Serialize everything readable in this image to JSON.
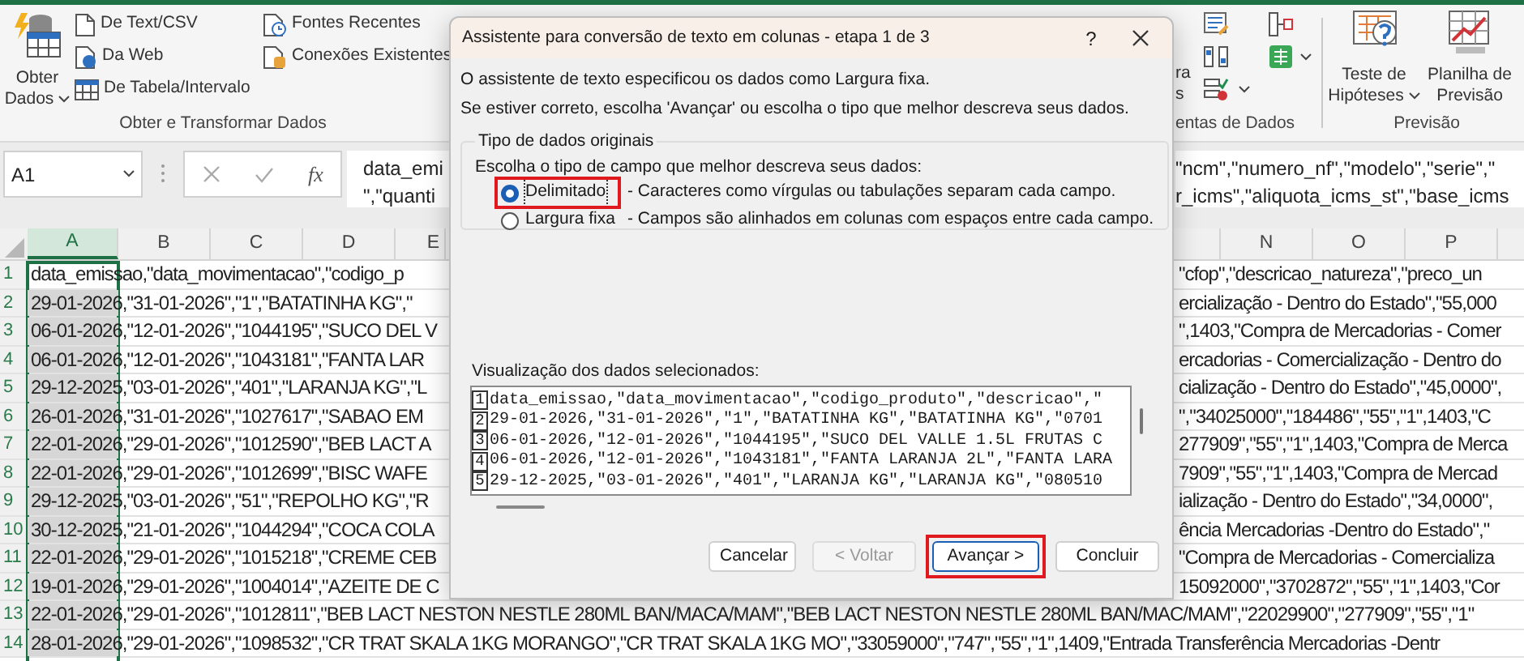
{
  "ribbon": {
    "groups": [
      {
        "label": "Obter e Transformar Dados",
        "items": [
          {
            "kind": "large",
            "lines": [
              "Obter",
              "Dados"
            ],
            "dropdown": true
          },
          {
            "kind": "small",
            "label": "De Text/CSV"
          },
          {
            "kind": "small",
            "label": "Da Web"
          },
          {
            "kind": "small",
            "label": "De Tabela/Intervalo"
          },
          {
            "kind": "small",
            "label": "Fontes Recentes"
          },
          {
            "kind": "small",
            "label": "Conexões Existentes"
          }
        ]
      },
      {
        "label": "entas de Dados",
        "items": [
          {
            "kind": "fragment",
            "lines": [
              "ra",
              "s"
            ]
          }
        ]
      },
      {
        "label": "Previsão",
        "items": [
          {
            "kind": "large",
            "lines": [
              "Teste de",
              "Hipóteses"
            ],
            "dropdown": true
          },
          {
            "kind": "large",
            "lines": [
              "Planilha de",
              "Previsão"
            ],
            "dropdown": false
          }
        ]
      }
    ]
  },
  "formula_bar": {
    "name_box": "A1",
    "function_label": "fx",
    "lines_left": [
      "data_emi",
      "\",\"quanti"
    ],
    "lines_right": [
      "\"ncm\",\"numero_nf\",\"modelo\",\"serie\",\"",
      "r_icms\",\"aliquota_icms_st\",\"base_icms"
    ]
  },
  "sheet": {
    "columns_left": [
      {
        "label": "A",
        "selected": true
      },
      {
        "label": "B",
        "selected": false
      },
      {
        "label": "C",
        "selected": false
      },
      {
        "label": "D",
        "selected": false
      },
      {
        "label": "E",
        "selected": false
      }
    ],
    "columns_right": [
      {
        "label": "N",
        "selected": false
      },
      {
        "label": "O",
        "selected": false
      },
      {
        "label": "P",
        "selected": false
      }
    ],
    "rows": [
      {
        "number": "1",
        "kind": "split",
        "selected": false,
        "left": "data_emissao,\"data_movimentacao\",\"codigo_p",
        "right": "\"cfop\",\"descricao_natureza\",\"preco_un"
      },
      {
        "number": "2",
        "kind": "split",
        "selected": true,
        "left": "29-01-2026,\"31-01-2026\",\"1\",\"BATATINHA KG\",\"",
        "right": "ercialização - Dentro do Estado\",\"55,000"
      },
      {
        "number": "3",
        "kind": "split",
        "selected": true,
        "left": "06-01-2026,\"12-01-2026\",\"1044195\",\"SUCO DEL V",
        "right": "\",1403,\"Compra de Mercadorias - Comer"
      },
      {
        "number": "4",
        "kind": "split",
        "selected": true,
        "left": "06-01-2026,\"12-01-2026\",\"1043181\",\"FANTA LAR",
        "right": "ercadorias - Comercialização - Dentro do"
      },
      {
        "number": "5",
        "kind": "split",
        "selected": true,
        "left": "29-12-2025,\"03-01-2026\",\"401\",\"LARANJA KG\",\"L",
        "right": "cialização - Dentro do Estado\",\"45,0000\","
      },
      {
        "number": "6",
        "kind": "split",
        "selected": true,
        "left": "26-01-2026,\"31-01-2026\",\"1027617\",\"SABAO EM",
        "right": "\",\"34025000\",\"184486\",\"55\",\"1\",1403,\"C"
      },
      {
        "number": "7",
        "kind": "split",
        "selected": true,
        "left": "22-01-2026,\"29-01-2026\",\"1012590\",\"BEB LACT A",
        "right": "277909\",\"55\",\"1\",1403,\"Compra de Merca"
      },
      {
        "number": "8",
        "kind": "split",
        "selected": true,
        "left": "22-01-2026,\"29-01-2026\",\"1012699\",\"BISC WAFE",
        "right": "7909\",\"55\",\"1\",1403,\"Compra de Mercad"
      },
      {
        "number": "9",
        "kind": "split",
        "selected": true,
        "left": "29-12-2025,\"03-01-2026\",\"51\",\"REPOLHO KG\",\"R",
        "right": "ialização - Dentro do Estado\",\"34,0000\","
      },
      {
        "number": "10",
        "kind": "split",
        "selected": true,
        "left": "30-12-2025,\"21-01-2026\",\"1044294\",\"COCA COLA",
        "right": "ência Mercadorias -Dentro do Estado\",\""
      },
      {
        "number": "11",
        "kind": "split",
        "selected": true,
        "left": "22-01-2026,\"29-01-2026\",\"1015218\",\"CREME CEB",
        "right": "\"Compra de Mercadorias - Comercializa"
      },
      {
        "number": "12",
        "kind": "split",
        "selected": true,
        "left": "19-01-2026,\"29-01-2026\",\"1004014\",\"AZEITE DE C",
        "right": "15092000\",\"3702872\",\"55\",\"1\",1403,\"Cor"
      },
      {
        "number": "13",
        "kind": "full",
        "selected": true,
        "text": "22-01-2026,\"29-01-2026\",\"1012811\",\"BEB LACT NESTON NESTLE 280ML BAN/MACA/MAM\",\"BEB LACT NESTON NESTLE 280ML BAN/MAC/MAM\",\"22029900\",\"277909\",\"55\",\"1\""
      },
      {
        "number": "14",
        "kind": "full",
        "selected": true,
        "text": "28-01-2026,\"29-01-2026\",\"1098532\",\"CR TRAT SKALA 1KG MORANGO\",\"CR TRAT SKALA 1KG MO\",\"33059000\",\"747\",\"55\",\"1\",1409,\"Entrada Transferência Mercadorias -Dentr"
      }
    ]
  },
  "dialog": {
    "title": "Assistente para conversão de texto em colunas - etapa 1 de 3",
    "help": "?",
    "intro": [
      "O assistente de texto especificou os dados como Largura fixa.",
      "Se estiver correto, escolha 'Avançar' ou escolha o tipo que melhor descreva seus dados."
    ],
    "group": {
      "title": "Tipo de dados originais",
      "prompt": "Escolha o tipo de campo que melhor descreva seus dados:",
      "options": [
        {
          "label": "Delimitado",
          "description": "- Caracteres como vírgulas ou tabulações separam cada campo.",
          "selected": true,
          "highlighted": true
        },
        {
          "label": "Largura fixa",
          "description": "- Campos são alinhados em colunas com espaços entre cada campo.",
          "selected": false,
          "highlighted": false
        }
      ]
    },
    "preview": {
      "title": "Visualização dos dados selecionados:",
      "lines": [
        {
          "number": "1",
          "text": "data_emissao,\"data_movimentacao\",\"codigo_produto\",\"descricao\",\""
        },
        {
          "number": "2",
          "text": "29-01-2026,\"31-01-2026\",\"1\",\"BATATINHA KG\",\"BATATINHA KG\",\"0701"
        },
        {
          "number": "3",
          "text": "06-01-2026,\"12-01-2026\",\"1044195\",\"SUCO DEL VALLE 1.5L FRUTAS C"
        },
        {
          "number": "4",
          "text": "06-01-2026,\"12-01-2026\",\"1043181\",\"FANTA LARANJA 2L\",\"FANTA LARA"
        },
        {
          "number": "5",
          "text": "29-12-2025,\"03-01-2026\",\"401\",\"LARANJA KG\",\"LARANJA KG\",\"080510"
        }
      ]
    },
    "buttons": [
      {
        "label": "Cancelar",
        "disabled": false,
        "default": false,
        "highlighted": false
      },
      {
        "label": "< Voltar",
        "disabled": true,
        "default": false,
        "highlighted": false
      },
      {
        "label": "Avançar >",
        "disabled": false,
        "default": true,
        "highlighted": true
      },
      {
        "label": "Concluir",
        "disabled": false,
        "default": false,
        "highlighted": false
      }
    ]
  }
}
